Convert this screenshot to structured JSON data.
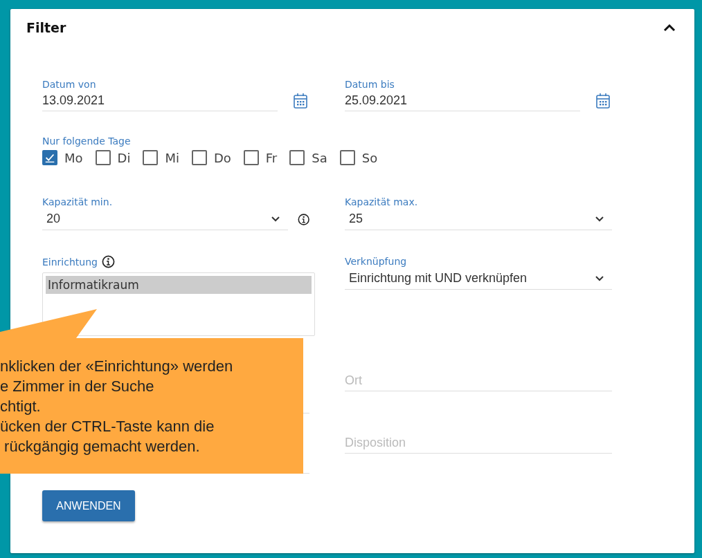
{
  "panel": {
    "title": "Filter",
    "expanded": true
  },
  "date_from": {
    "label": "Datum von",
    "value": "13.09.2021"
  },
  "date_to": {
    "label": "Datum bis",
    "value": "25.09.2021"
  },
  "days": {
    "label": "Nur folgende Tage",
    "items": [
      {
        "label": "Mo",
        "checked": true
      },
      {
        "label": "Di",
        "checked": false
      },
      {
        "label": "Mi",
        "checked": false
      },
      {
        "label": "Do",
        "checked": false
      },
      {
        "label": "Fr",
        "checked": false
      },
      {
        "label": "Sa",
        "checked": false
      },
      {
        "label": "So",
        "checked": false
      }
    ]
  },
  "capacity_min": {
    "label": "Kapazität min.",
    "value": "20"
  },
  "capacity_max": {
    "label": "Kapazität max.",
    "value": "25"
  },
  "equipment": {
    "label": "Einrichtung",
    "items": [
      {
        "label": "Informatikraum",
        "selected": true
      }
    ]
  },
  "link_mode": {
    "label": "Verknüpfung",
    "value": "Einrichtung mit UND verknüpfen"
  },
  "location": {
    "placeholder": "Ort"
  },
  "disposition": {
    "placeholder": "Disposition"
  },
  "apply_button": "ANWENDEN",
  "callout": {
    "lines": [
      "nklicken der «Einrichtung» werden",
      "e Zimmer in der Suche",
      "chtigt.",
      "ücken der CTRL-Taste kann die",
      " rückgängig gemacht werden."
    ]
  }
}
